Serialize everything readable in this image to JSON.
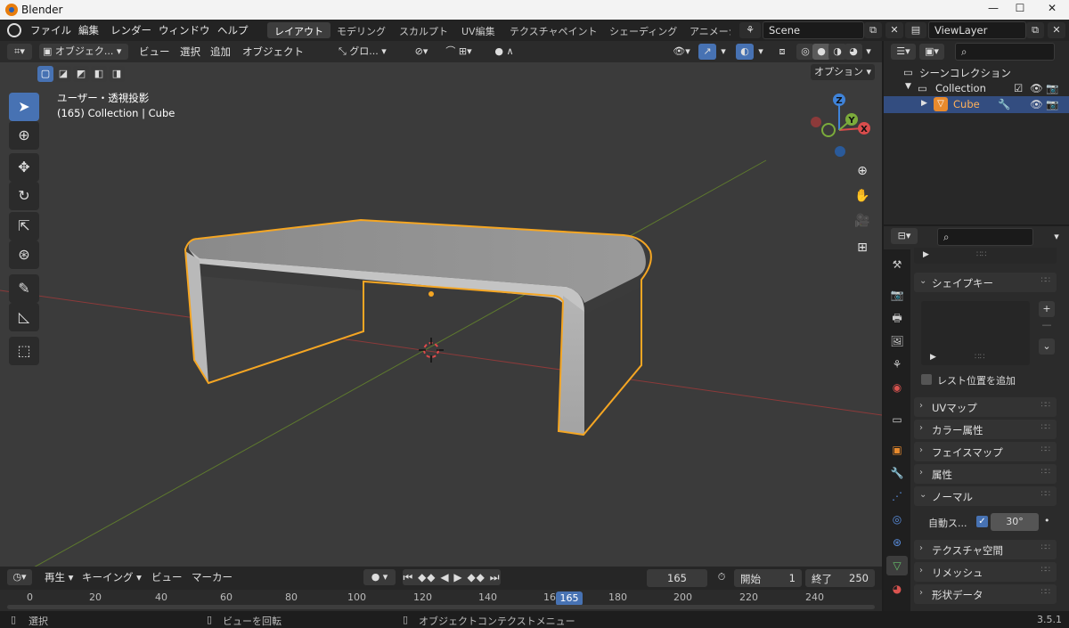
{
  "window": {
    "app_title": "Blender",
    "minimize": "—",
    "maximize": "☐",
    "close": "✕"
  },
  "menu": [
    "ファイル",
    "編集",
    "レンダー",
    "ウィンドウ",
    "ヘルプ"
  ],
  "workspaces": [
    {
      "label": "レイアウト",
      "active": true
    },
    {
      "label": "モデリング",
      "active": false
    },
    {
      "label": "スカルプト",
      "active": false
    },
    {
      "label": "UV編集",
      "active": false
    },
    {
      "label": "テクスチャペイント",
      "active": false
    },
    {
      "label": "シェーディング",
      "active": false
    },
    {
      "label": "アニメーシ",
      "active": false
    }
  ],
  "scene_field": "Scene",
  "viewlayer_field": "ViewLayer",
  "viewport_header": {
    "mode": "オブジェク...",
    "items": [
      "ビュー",
      "選択",
      "追加",
      "オブジェクト"
    ],
    "transform": "グロ...",
    "options": "オプション"
  },
  "viewport": {
    "view_name": "ユーザー・透視投影",
    "collection_line": "(165) Collection | Cube",
    "gizmo": {
      "z": "Z",
      "y": "Y",
      "x": "X"
    }
  },
  "timeline_header": {
    "playback": "再生",
    "keying": "キーイング",
    "view": "ビュー",
    "marker": "マーカー",
    "current_frame": "165",
    "start_label": "開始",
    "start_value": "1",
    "end_label": "終了",
    "end_value": "250"
  },
  "timeline": {
    "ticks": [
      "0",
      "20",
      "40",
      "60",
      "80",
      "100",
      "120",
      "140",
      "160",
      "180",
      "200",
      "220",
      "240"
    ],
    "playhead": "165"
  },
  "statusbar": {
    "select": "選択",
    "rotate": "ビューを回転",
    "context_menu": "オブジェクトコンテクストメニュー",
    "version": "3.5.1"
  },
  "outliner": {
    "scene_collection": "シーンコレクション",
    "collection": "Collection",
    "cube": "Cube"
  },
  "properties": {
    "shape_keys": "シェイプキー",
    "rest_position": "レスト位置を追加",
    "uv_maps": "UVマップ",
    "color_attributes": "カラー属性",
    "face_maps": "フェイスマップ",
    "attributes": "属性",
    "normals": "ノーマル",
    "auto_smooth": "自動ス...",
    "auto_smooth_angle": "30°",
    "texture_space": "テクスチャ空間",
    "remesh": "リメッシュ",
    "geometry_data": "形状データ"
  },
  "colors": {
    "accent": "#4772b3",
    "selection_outline": "#f5a623",
    "axis_x": "#d94c4c",
    "axis_y": "#7bab3b",
    "axis_z": "#3f83d9"
  }
}
